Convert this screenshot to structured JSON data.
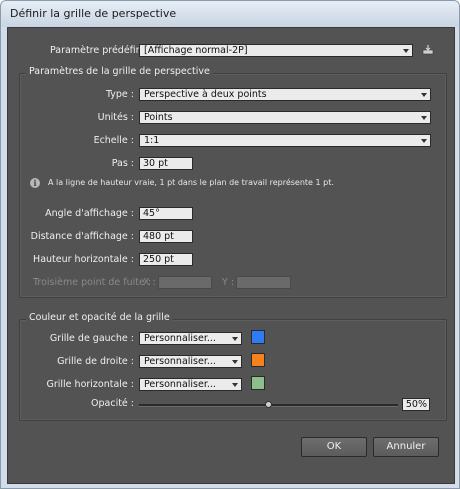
{
  "window": {
    "title": "Définir la grille de perspective"
  },
  "preset": {
    "label": "Paramètre prédéfini :",
    "value": "[Affichage normal-2P]",
    "save_icon": "save-preset-icon"
  },
  "grid_settings": {
    "title": "Paramètres de la grille de perspective",
    "type": {
      "label": "Type :",
      "value": "Perspective à deux points"
    },
    "units": {
      "label": "Unités :",
      "value": "Points"
    },
    "scale": {
      "label": "Echelle :",
      "value": "1:1"
    },
    "step": {
      "label": "Pas :",
      "value": "30 pt"
    },
    "info_icon": "info-icon",
    "info": "A la ligne de hauteur vraie, 1 pt dans le plan de travail représente 1 pt.",
    "view_angle": {
      "label": "Angle d'affichage :",
      "value": "45°"
    },
    "view_distance": {
      "label": "Distance d'affichage :",
      "value": "480 pt"
    },
    "horizon_height": {
      "label": "Hauteur horizontale :",
      "value": "250 pt"
    },
    "third_vp": {
      "label": "Troisième point de fuite :",
      "x_label": "X :",
      "x_value": "",
      "y_label": "Y :",
      "y_value": ""
    }
  },
  "color_settings": {
    "title": "Couleur et opacité de la grille",
    "left": {
      "label": "Grille de gauche :",
      "value": "Personnaliser...",
      "color": "#2f7bf5"
    },
    "right": {
      "label": "Grille de droite :",
      "value": "Personnaliser...",
      "color": "#f5821f"
    },
    "horizontal": {
      "label": "Grille horizontale :",
      "value": "Personnaliser...",
      "color": "#8cbf8c"
    },
    "opacity": {
      "label": "Opacité :",
      "value": "50%",
      "level_percent": 50
    }
  },
  "buttons": {
    "ok": "OK",
    "cancel": "Annuler"
  }
}
